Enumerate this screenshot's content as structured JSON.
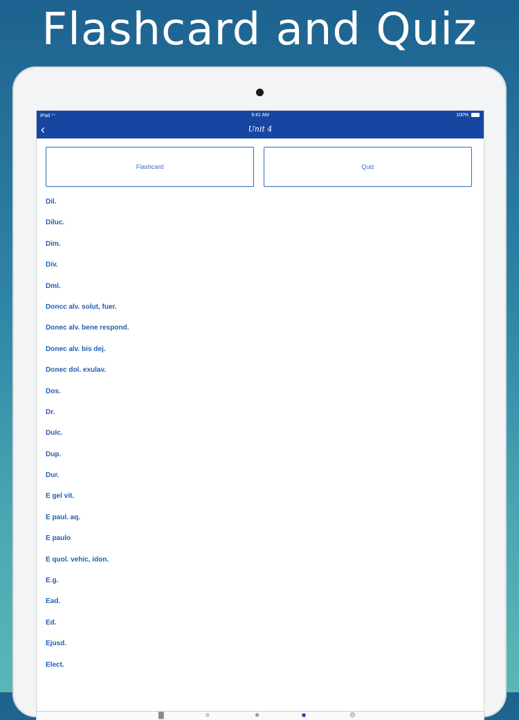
{
  "headline": "Flashcard and Quiz",
  "status": {
    "device": "iPad",
    "wifi_icon": "wifi-icon",
    "time": "9:41 AM",
    "battery": "100%"
  },
  "nav": {
    "back_icon": "chevron-left-icon",
    "title": "Unit 4"
  },
  "buttons": {
    "flashcard": "Flashcard",
    "quiz": "Quiz"
  },
  "list": [
    "Dil.",
    "Diluc.",
    "Dim.",
    "Div.",
    "Dml.",
    "Doncc alv. solut, fuer.",
    "Donec alv. bene respond.",
    "Donec alv. bis dej.",
    "Donec dol. exulav.",
    "Dos.",
    "Dr.",
    "Dulc.",
    "Dup.",
    "Dur.",
    "E gel vit.",
    "E paul. aq.",
    "E paulo",
    "E quol. vehic, idon.",
    "E.g.",
    "Ead.",
    "Ed.",
    "Ejusd.",
    "Elect."
  ],
  "tabbar": [
    "chart-icon",
    "list-icon",
    "star-icon",
    "book-icon",
    "gear-icon"
  ],
  "colors": {
    "nav_bar": "#1645a2",
    "accent_text": "#1f5fb4",
    "button_border": "#2f67c0"
  }
}
